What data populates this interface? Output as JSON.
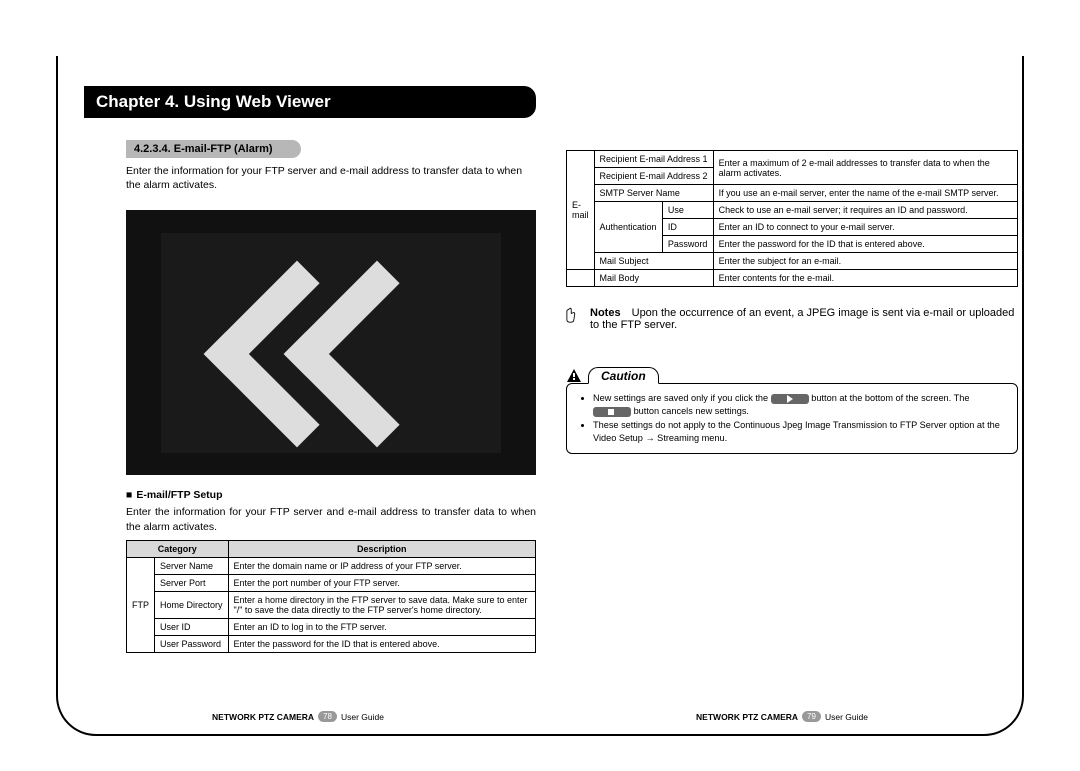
{
  "chapter_title": "Chapter 4. Using Web Viewer",
  "section": {
    "number_title": "4.2.3.4. E-mail-FTP (Alarm)",
    "intro": "Enter the information for your FTP server and e-mail address to transfer data to when the alarm activates."
  },
  "setup": {
    "heading": "E-mail/FTP Setup",
    "intro": "Enter the information for your FTP server and e-mail address to transfer data to when the alarm activates.",
    "headers": {
      "category": "Category",
      "description": "Description"
    },
    "ftp_group": "FTP",
    "ftp_rows": [
      {
        "name": "Server Name",
        "desc": "Enter the domain name or IP address of your FTP server."
      },
      {
        "name": "Server Port",
        "desc": "Enter the port number of your FTP server."
      },
      {
        "name": "Home Directory",
        "desc": "Enter a home directory in the FTP server to save data. Make sure to enter \"/\" to save the data directly to the FTP server's home directory."
      },
      {
        "name": "User ID",
        "desc": "Enter an ID to log in to the FTP server."
      },
      {
        "name": "User Password",
        "desc": "Enter the password for the ID that is entered above."
      }
    ]
  },
  "email": {
    "group": "E-mail",
    "recip1_label": "Recipient E-mail Address 1",
    "recip2_label": "Recipient E-mail Address 2",
    "recip_desc": "Enter a maximum of 2 e-mail addresses to transfer data to when the alarm activates.",
    "smtp_label": "SMTP Server Name",
    "smtp_desc": "If you use an e-mail server, enter the name of the e-mail SMTP server.",
    "auth_label": "Authentication",
    "auth_use": {
      "name": "Use",
      "desc": "Check to use an e-mail server; it requires an ID and password."
    },
    "auth_id": {
      "name": "ID",
      "desc": "Enter an ID to connect to your e-mail server."
    },
    "auth_pw": {
      "name": "Password",
      "desc": "Enter the password for the ID that is entered above."
    },
    "subject": {
      "name": "Mail Subject",
      "desc": "Enter the subject for an e-mail."
    },
    "body": {
      "name": "Mail Body",
      "desc": "Enter contents for the e-mail."
    }
  },
  "note": {
    "title": "Notes",
    "text": "Upon the occurrence of an event, a JPEG image is sent via e-mail or uploaded to the FTP server."
  },
  "caution": {
    "label": "Caution",
    "line1a": "New settings are saved only if you click the",
    "line1b": "button at the bottom of the screen. The",
    "line1c": "button cancels new settings.",
    "line2": "These settings do not apply to the Continuous Jpeg Image Transmission to FTP Server option at the Video Setup → Streaming menu."
  },
  "footer": {
    "product": "NETWORK PTZ CAMERA",
    "guide": "User Guide",
    "page_left": "78",
    "page_right": "79"
  }
}
